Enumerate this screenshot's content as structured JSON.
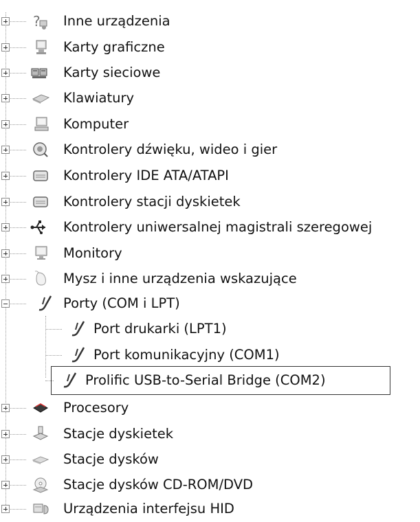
{
  "tree": {
    "categories": [
      {
        "label": "Inne urządzenia",
        "icon": "unknown-device-icon"
      },
      {
        "label": "Karty graficzne",
        "icon": "display-adapter-icon"
      },
      {
        "label": "Karty sieciowe",
        "icon": "network-adapter-icon"
      },
      {
        "label": "Klawiatury",
        "icon": "keyboard-icon"
      },
      {
        "label": "Komputer",
        "icon": "computer-icon"
      },
      {
        "label": "Kontrolery dźwięku, wideo i gier",
        "icon": "sound-icon"
      },
      {
        "label": "Kontrolery IDE ATA/ATAPI",
        "icon": "ide-controller-icon"
      },
      {
        "label": "Kontrolery stacji dyskietek",
        "icon": "floppy-controller-icon"
      },
      {
        "label": "Kontrolery uniwersalnej magistrali szeregowej",
        "icon": "usb-icon"
      },
      {
        "label": "Monitory",
        "icon": "monitor-icon"
      },
      {
        "label": "Mysz i inne urządzenia wskazujące",
        "icon": "mouse-icon"
      },
      {
        "label": "Porty (COM i LPT)",
        "icon": "port-icon",
        "expanded": true
      },
      {
        "label": "Procesory",
        "icon": "processor-icon"
      },
      {
        "label": "Stacje dyskietek",
        "icon": "floppy-drive-icon"
      },
      {
        "label": "Stacje dysków",
        "icon": "disk-drive-icon"
      },
      {
        "label": "Stacje dysków CD-ROM/DVD",
        "icon": "cdrom-icon"
      },
      {
        "label": "Urządzenia interfejsu HID",
        "icon": "hid-icon"
      }
    ],
    "ports_children": [
      {
        "label": "Port drukarki (LPT1)",
        "icon": "port-icon"
      },
      {
        "label": "Port komunikacyjny (COM1)",
        "icon": "port-icon"
      },
      {
        "label": "Prolific USB-to-Serial Bridge (COM2)",
        "icon": "port-icon",
        "selected": true
      }
    ]
  }
}
